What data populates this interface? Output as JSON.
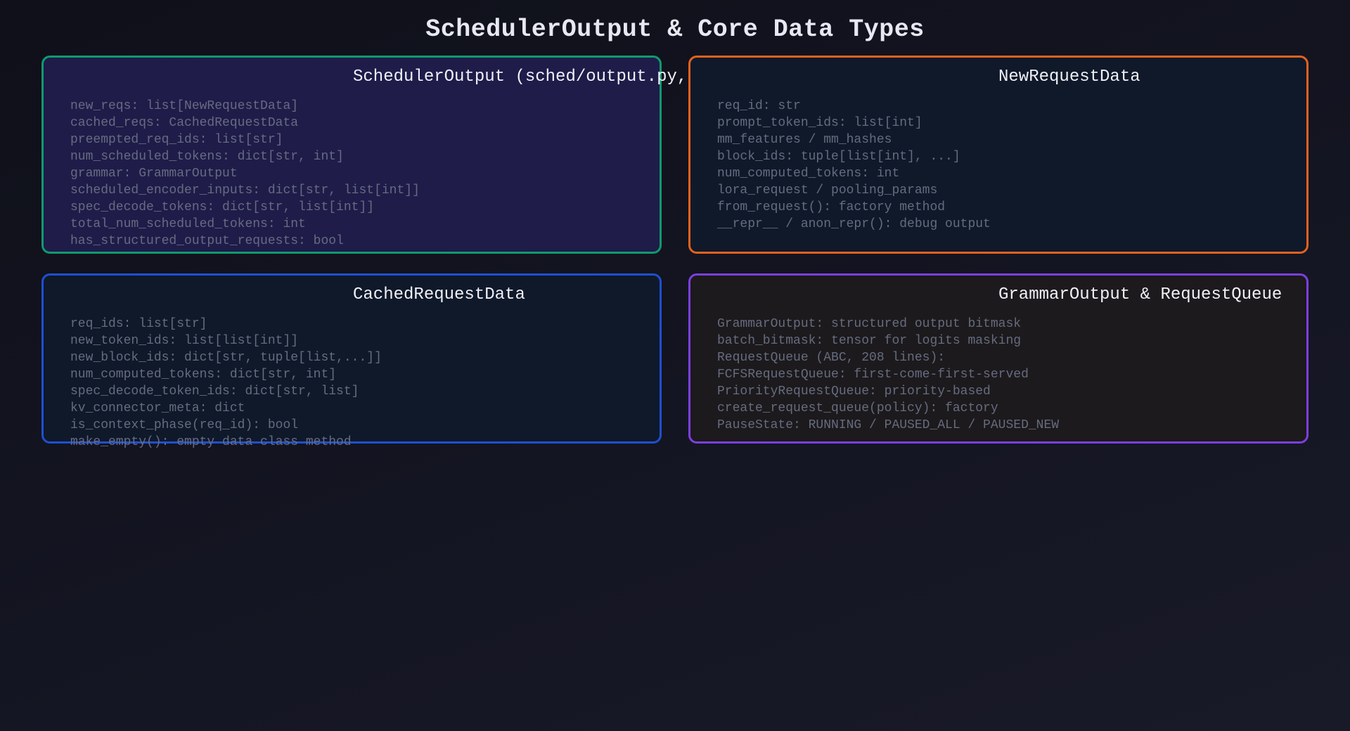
{
  "title": "SchedulerOutput & Core Data Types",
  "cards": [
    {
      "title": "SchedulerOutput (sched/output.py,",
      "border_color": "#109a6e",
      "background": "#1f1c4a",
      "fields": [
        "new_reqs: list[NewRequestData]",
        "cached_reqs: CachedRequestData",
        "preempted_req_ids: list[str]",
        "num_scheduled_tokens: dict[str, int]",
        "grammar: GrammarOutput",
        "scheduled_encoder_inputs: dict[str, list[int]]",
        "spec_decode_tokens: dict[str, list[int]]",
        "total_num_scheduled_tokens: int",
        "has_structured_output_requests: bool"
      ]
    },
    {
      "title": "NewRequestData",
      "border_color": "#e4611e",
      "background": "#0f192a",
      "fields": [
        "req_id: str",
        "prompt_token_ids: list[int]",
        "mm_features / mm_hashes",
        "block_ids: tuple[list[int], ...]",
        "num_computed_tokens: int",
        "lora_request / pooling_params",
        "from_request(): factory method",
        "__repr__ / anon_repr(): debug output"
      ]
    },
    {
      "title": "CachedRequestData",
      "border_color": "#1f4fd1",
      "background": "#0f192a",
      "fields": [
        "req_ids: list[str]",
        "new_token_ids: list[list[int]]",
        "new_block_ids: dict[str, tuple[list,...]]",
        "num_computed_tokens: dict[str, int]",
        "spec_decode_token_ids: dict[str, list]",
        "kv_connector_meta: dict",
        "is_context_phase(req_id): bool",
        "make_empty(): empty data class method"
      ]
    },
    {
      "title": "GrammarOutput & RequestQueue",
      "border_color": "#7c3fe0",
      "background": "#1c1a1c",
      "fields": [
        "GrammarOutput: structured output bitmask",
        "batch_bitmask: tensor for logits masking",
        "RequestQueue (ABC, 208 lines):",
        "FCFSRequestQueue: first-come-first-served",
        "PriorityRequestQueue: priority-based",
        "create_request_queue(policy): factory",
        "PauseState: RUNNING / PAUSED_ALL / PAUSED_NEW"
      ]
    }
  ]
}
